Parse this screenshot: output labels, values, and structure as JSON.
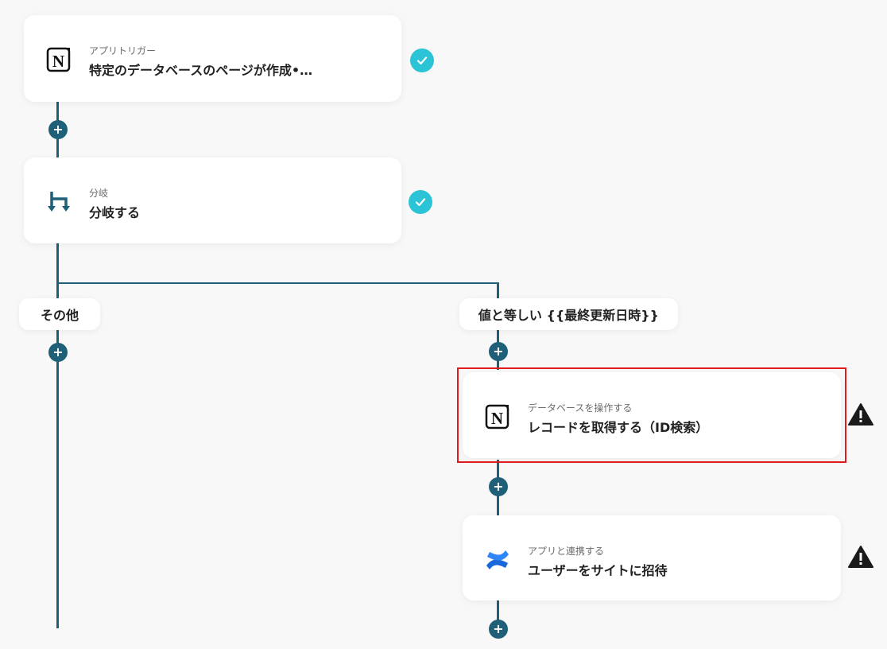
{
  "trigger_step": {
    "subtitle": "アプリトリガー",
    "title": "特定のデータベースのページが作成•…",
    "icon": "notion-icon",
    "status": "completed"
  },
  "branch_step": {
    "subtitle": "分岐",
    "title": "分岐する",
    "icon": "branch-icon",
    "status": "completed"
  },
  "branches": {
    "other_label": "その他",
    "condition_label": "値と等しい {{最終更新日時}}"
  },
  "db_step": {
    "subtitle": "データベースを操作する",
    "title": "レコードを取得する（ID検索）",
    "icon": "notion-icon",
    "status": "warning"
  },
  "app_step": {
    "subtitle": "アプリと連携する",
    "title": "ユーザーをサイトに招待",
    "icon": "confluence-icon",
    "status": "warning"
  },
  "colors": {
    "connector": "#1f5f78",
    "check": "#2bc4d6",
    "highlight": "#e01b1b",
    "warning": "#1a1a1a"
  }
}
